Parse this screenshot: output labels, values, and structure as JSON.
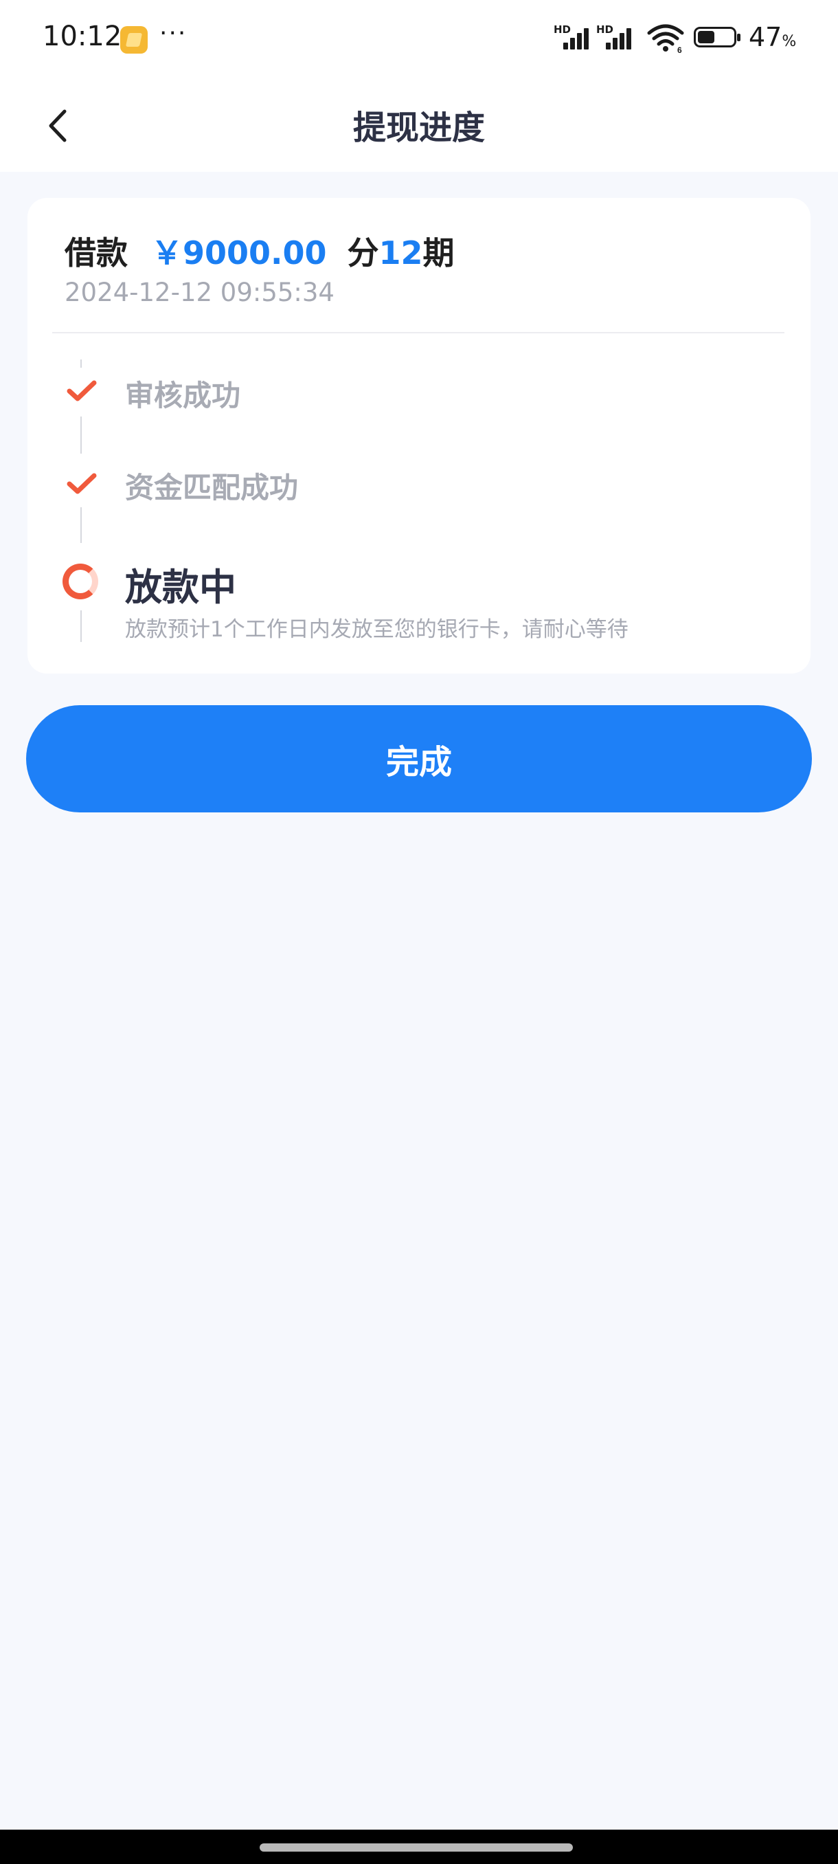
{
  "status_bar": {
    "time": "10:12",
    "more": "···",
    "signal_1_label": "HD",
    "signal_2_label": "HD",
    "battery_percent": "47",
    "battery_unit": "%"
  },
  "header": {
    "title": "提现进度",
    "back_icon": "chevron-left-icon"
  },
  "loan": {
    "label": "借款",
    "amount": "￥9000.00",
    "period_prefix": "分",
    "period_count": "12",
    "period_suffix": "期",
    "datetime": "2024-12-12 09:55:34"
  },
  "steps": [
    {
      "label": "审核成功",
      "status": "done",
      "icon": "check-icon"
    },
    {
      "label": "资金匹配成功",
      "status": "done",
      "icon": "check-icon"
    },
    {
      "label": "放款中",
      "status": "in-progress",
      "icon": "spinner-icon",
      "description": "放款预计1个工作日内发放至您的银行卡，请耐心等待"
    }
  ],
  "actions": {
    "done_label": "完成"
  },
  "colors": {
    "accent": "#1e80f7",
    "success_check": "#f05a3c",
    "muted_text": "#a6a9b3",
    "page_background": "#f6f8fd"
  }
}
